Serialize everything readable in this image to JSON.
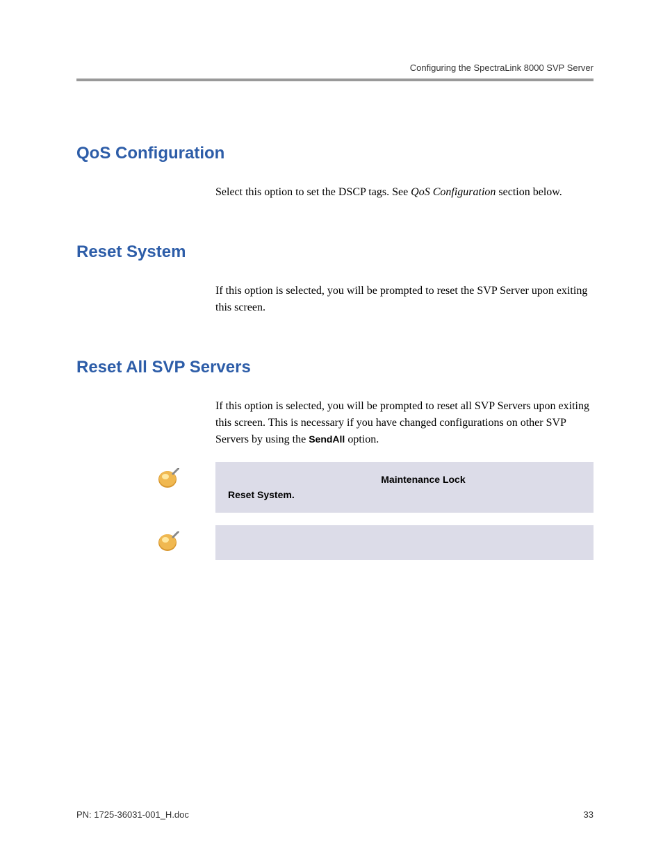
{
  "header": {
    "running_title": "Configuring the SpectraLink 8000 SVP Server"
  },
  "sections": {
    "qos": {
      "heading": "QoS Configuration",
      "body_pre": "Select this option to set the DSCP tags. See ",
      "body_italic": "QoS Configuration",
      "body_post": " section below."
    },
    "reset_system": {
      "heading": "Reset System",
      "body": "If this option is selected, you will be prompted to reset the SVP Server upon exiting this screen."
    },
    "reset_all": {
      "heading": "Reset All SVP Servers",
      "body_pre": "If this option is selected, you will be prompted to reset all SVP Servers upon exiting this screen. This is necessary if you have changed configurations on other SVP Servers by using the ",
      "body_bold": "SendAll",
      "body_post": " option."
    }
  },
  "notes": {
    "note1": {
      "bold1": "Maintenance Lock",
      "bold2": "Reset System."
    }
  },
  "footer": {
    "doc_id": "PN: 1725-36031-001_H.doc",
    "page_num": "33"
  }
}
